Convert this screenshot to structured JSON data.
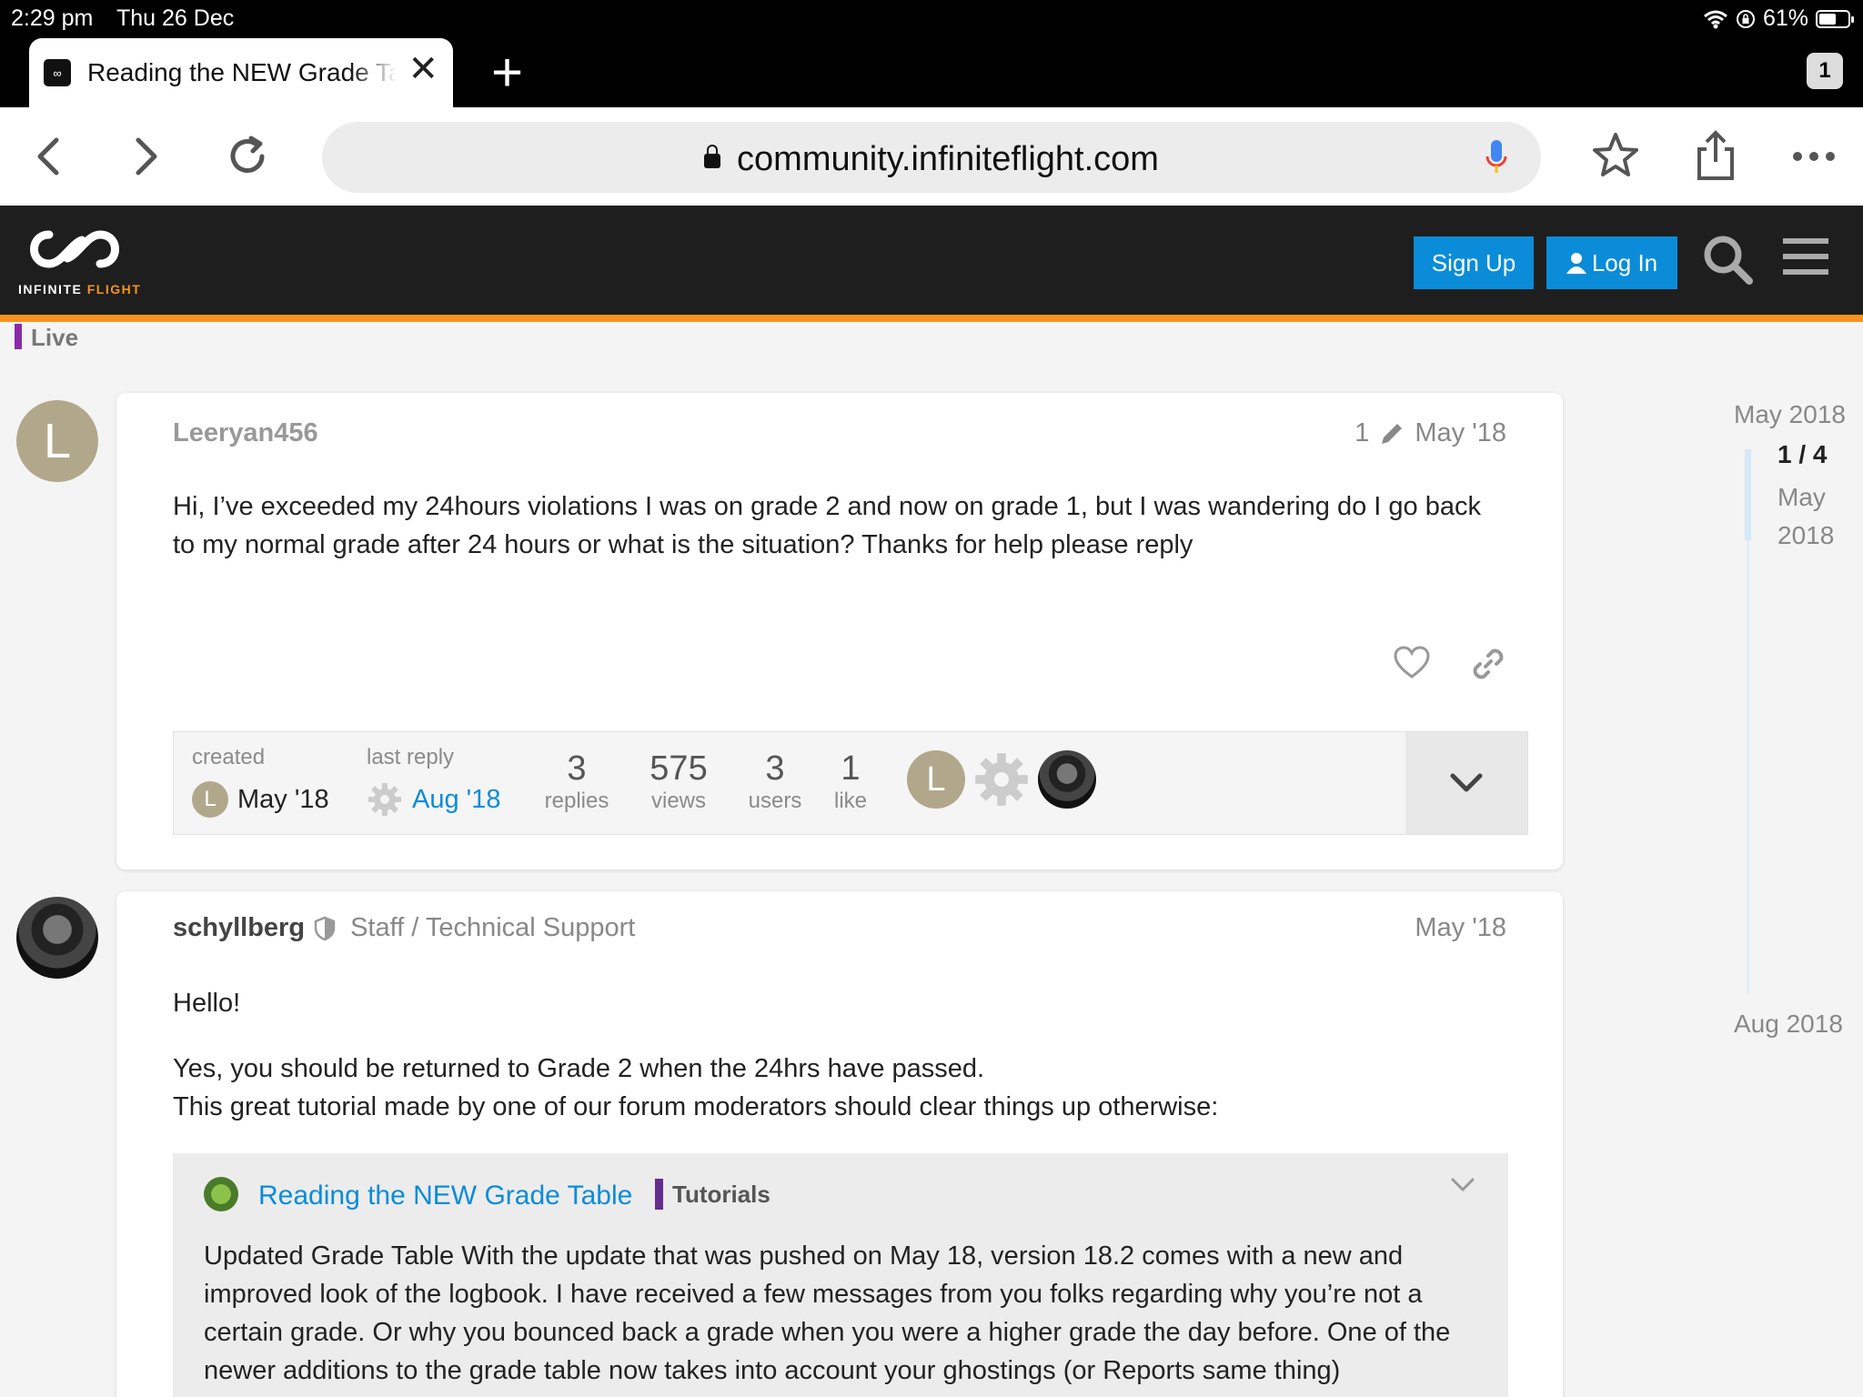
{
  "status_bar": {
    "time": "2:29 pm",
    "date": "Thu 26 Dec",
    "battery": "61%",
    "battery_level": 0.61
  },
  "browser": {
    "tab_title": "Reading the NEW Grade Table",
    "tab_count": "1",
    "url": "community.infiniteflight.com",
    "icons": [
      "back-icon",
      "forward-icon",
      "reload-icon",
      "lock-icon",
      "microphone-icon",
      "bookmark-star-icon",
      "share-icon",
      "more-icon"
    ]
  },
  "site_header": {
    "logo_text_1": "INFINITE",
    "logo_text_2": "FLIGHT",
    "signup_label": "Sign Up",
    "login_label": "Log In",
    "accent": "#f7931e",
    "button_color": "#0a8cd8"
  },
  "category": "Live",
  "posts": [
    {
      "avatar_letter": "L",
      "username": "Leeryan456",
      "edit_count": "1",
      "date": "May '18",
      "body": "Hi, I’ve exceeded my 24hours violations I was on grade 2 and now on grade 1, but I was wandering do I go back to my normal grade after 24 hours or what is the situation? Thanks for help please reply"
    },
    {
      "username": "schyllberg",
      "title": "Staff / Technical Support",
      "date": "May '18",
      "greeting": "Hello!",
      "line1": "Yes, you should be returned to Grade 2 when the 24hrs have passed.",
      "line2": "This great tutorial made by one of our forum moderators should clear things up otherwise:",
      "quote": {
        "title": "Reading the NEW Grade Table",
        "category": "Tutorials",
        "body": "Updated Grade Table With the update that was pushed on May 18, version 18.2 comes with a new and improved look of the logbook. I have received a few messages from you folks regarding why you’re not a certain grade. Or why you bounced back a grade when you were a higher grade the day before. One of the newer additions to the grade table now takes into account your ghostings (or Reports same thing)"
      }
    }
  ],
  "topic_map": {
    "created_label": "created",
    "created_avatar": "L",
    "created_date": "May '18",
    "last_reply_label": "last reply",
    "last_reply_date": "Aug '18",
    "replies_num": "3",
    "replies_label": "replies",
    "views_num": "575",
    "views_label": "views",
    "users_num": "3",
    "users_label": "users",
    "likes_num": "1",
    "likes_label": "like",
    "participant_letter": "L"
  },
  "timeline": {
    "top": "May 2018",
    "position": "1 / 4",
    "current_month": "May",
    "current_year": "2018",
    "bottom": "Aug 2018"
  }
}
